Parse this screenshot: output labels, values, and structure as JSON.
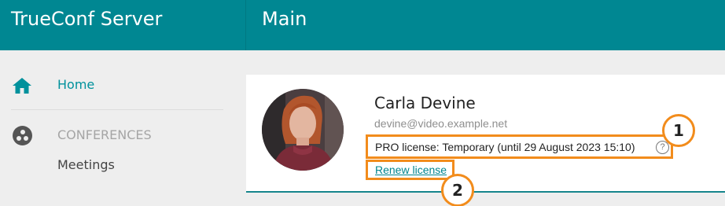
{
  "app": {
    "brand": "TrueConf Server",
    "page_title": "Main"
  },
  "sidebar": {
    "home_label": "Home",
    "section_label": "CONFERENCES",
    "meetings_label": "Meetings"
  },
  "user": {
    "name": "Carla Devine",
    "email": "devine@video.example.net",
    "license_text": "PRO license: Temporary (until 29 August 2023 15:10)",
    "help_glyph": "?",
    "renew_link": "Renew license"
  },
  "annotations": {
    "marker_1": "1",
    "marker_2": "2"
  },
  "colors": {
    "header": "#008792",
    "accent": "#00919c",
    "highlight": "#f28c1c"
  },
  "icons": {
    "home": "home-icon",
    "conferences": "conferences-icon",
    "help": "help-icon"
  }
}
